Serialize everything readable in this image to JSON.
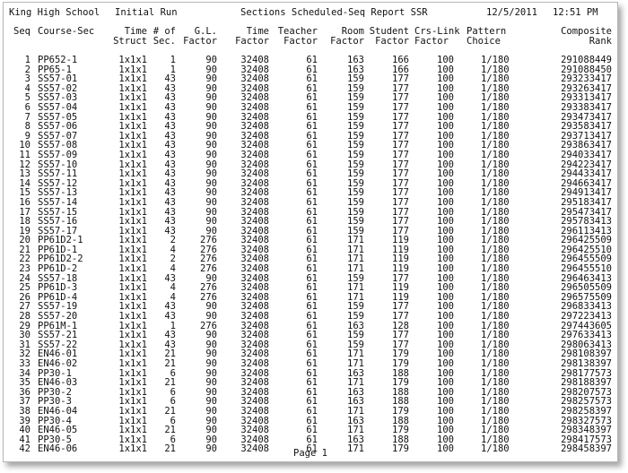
{
  "report": {
    "school": "King High School",
    "run": "Initial Run",
    "title": "Sections Scheduled-Seq Report SSR",
    "date": "12/5/2011",
    "time": "12:51 PM",
    "page_label": "Page 1"
  },
  "columns": {
    "seq": "Seq",
    "course": "Course-Sec",
    "time_struct_1": "Time",
    "time_struct_2": "Struct",
    "num_sec_1": "# of",
    "num_sec_2": "Sec.",
    "gl_1": "G.L.",
    "gl_2": "Factor",
    "time_factor_1": "Time",
    "time_factor_2": "Factor",
    "teacher_1": "Teacher",
    "teacher_2": "Factor",
    "room_1": "Room",
    "room_2": "Factor",
    "student_1": "Student",
    "student_2": "Factor",
    "crslink_1": "Crs-Link",
    "crslink_2": "Factor",
    "pattern_1": "Pattern",
    "pattern_2": "Choice",
    "rank_1": "Composite",
    "rank_2": "Rank"
  },
  "rows": [
    [
      "1",
      "PP652-1",
      "1x1x1",
      "1",
      "90",
      "32408",
      "61",
      "163",
      "166",
      "100",
      "1/180",
      "291088449"
    ],
    [
      "2",
      "PP65-1",
      "1x1x1",
      "1",
      "90",
      "32408",
      "61",
      "163",
      "166",
      "100",
      "1/180",
      "291088450"
    ],
    [
      "3",
      "SS57-01",
      "1x1x1",
      "43",
      "90",
      "32408",
      "61",
      "159",
      "177",
      "100",
      "1/180",
      "293233417"
    ],
    [
      "4",
      "SS57-02",
      "1x1x1",
      "43",
      "90",
      "32408",
      "61",
      "159",
      "177",
      "100",
      "1/180",
      "293263417"
    ],
    [
      "5",
      "SS57-03",
      "1x1x1",
      "43",
      "90",
      "32408",
      "61",
      "159",
      "177",
      "100",
      "1/180",
      "293313417"
    ],
    [
      "6",
      "SS57-04",
      "1x1x1",
      "43",
      "90",
      "32408",
      "61",
      "159",
      "177",
      "100",
      "1/180",
      "293383417"
    ],
    [
      "7",
      "SS57-05",
      "1x1x1",
      "43",
      "90",
      "32408",
      "61",
      "159",
      "177",
      "100",
      "1/180",
      "293473417"
    ],
    [
      "8",
      "SS57-06",
      "1x1x1",
      "43",
      "90",
      "32408",
      "61",
      "159",
      "177",
      "100",
      "1/180",
      "293583417"
    ],
    [
      "9",
      "SS57-07",
      "1x1x1",
      "43",
      "90",
      "32408",
      "61",
      "159",
      "177",
      "100",
      "1/180",
      "293713417"
    ],
    [
      "10",
      "SS57-08",
      "1x1x1",
      "43",
      "90",
      "32408",
      "61",
      "159",
      "177",
      "100",
      "1/180",
      "293863417"
    ],
    [
      "11",
      "SS57-09",
      "1x1x1",
      "43",
      "90",
      "32408",
      "61",
      "159",
      "177",
      "100",
      "1/180",
      "294033417"
    ],
    [
      "12",
      "SS57-10",
      "1x1x1",
      "43",
      "90",
      "32408",
      "61",
      "159",
      "177",
      "100",
      "1/180",
      "294223417"
    ],
    [
      "13",
      "SS57-11",
      "1x1x1",
      "43",
      "90",
      "32408",
      "61",
      "159",
      "177",
      "100",
      "1/180",
      "294433417"
    ],
    [
      "14",
      "SS57-12",
      "1x1x1",
      "43",
      "90",
      "32408",
      "61",
      "159",
      "177",
      "100",
      "1/180",
      "294663417"
    ],
    [
      "15",
      "SS57-13",
      "1x1x1",
      "43",
      "90",
      "32408",
      "61",
      "159",
      "177",
      "100",
      "1/180",
      "294913417"
    ],
    [
      "16",
      "SS57-14",
      "1x1x1",
      "43",
      "90",
      "32408",
      "61",
      "159",
      "177",
      "100",
      "1/180",
      "295183417"
    ],
    [
      "17",
      "SS57-15",
      "1x1x1",
      "43",
      "90",
      "32408",
      "61",
      "159",
      "177",
      "100",
      "1/180",
      "295473417"
    ],
    [
      "18",
      "SS57-16",
      "1x1x1",
      "43",
      "90",
      "32408",
      "61",
      "159",
      "177",
      "100",
      "1/180",
      "295783413"
    ],
    [
      "19",
      "SS57-17",
      "1x1x1",
      "43",
      "90",
      "32408",
      "61",
      "159",
      "177",
      "100",
      "1/180",
      "296113413"
    ],
    [
      "20",
      "PP61D2-1",
      "1x1x1",
      "2",
      "276",
      "32408",
      "61",
      "171",
      "119",
      "100",
      "1/180",
      "296425509"
    ],
    [
      "21",
      "PP61D-1",
      "1x1x1",
      "4",
      "276",
      "32408",
      "61",
      "171",
      "119",
      "100",
      "1/180",
      "296425510"
    ],
    [
      "22",
      "PP61D2-2",
      "1x1x1",
      "2",
      "276",
      "32408",
      "61",
      "171",
      "119",
      "100",
      "1/180",
      "296455509"
    ],
    [
      "23",
      "PP61D-2",
      "1x1x1",
      "4",
      "276",
      "32408",
      "61",
      "171",
      "119",
      "100",
      "1/180",
      "296455510"
    ],
    [
      "24",
      "SS57-18",
      "1x1x1",
      "43",
      "90",
      "32408",
      "61",
      "159",
      "177",
      "100",
      "1/180",
      "296463413"
    ],
    [
      "25",
      "PP61D-3",
      "1x1x1",
      "4",
      "276",
      "32408",
      "61",
      "171",
      "119",
      "100",
      "1/180",
      "296505509"
    ],
    [
      "26",
      "PP61D-4",
      "1x1x1",
      "4",
      "276",
      "32408",
      "61",
      "171",
      "119",
      "100",
      "1/180",
      "296575509"
    ],
    [
      "27",
      "SS57-19",
      "1x1x1",
      "43",
      "90",
      "32408",
      "61",
      "159",
      "177",
      "100",
      "1/180",
      "296833413"
    ],
    [
      "28",
      "SS57-20",
      "1x1x1",
      "43",
      "90",
      "32408",
      "61",
      "159",
      "177",
      "100",
      "1/180",
      "297223413"
    ],
    [
      "29",
      "PP61M-1",
      "1x1x1",
      "1",
      "276",
      "32408",
      "61",
      "163",
      "128",
      "100",
      "1/180",
      "297443605"
    ],
    [
      "30",
      "SS57-21",
      "1x1x1",
      "43",
      "90",
      "32408",
      "61",
      "159",
      "177",
      "100",
      "1/180",
      "297633413"
    ],
    [
      "31",
      "SS57-22",
      "1x1x1",
      "43",
      "90",
      "32408",
      "61",
      "159",
      "177",
      "100",
      "1/180",
      "298063413"
    ],
    [
      "32",
      "EN46-01",
      "1x1x1",
      "21",
      "90",
      "32408",
      "61",
      "171",
      "179",
      "100",
      "1/180",
      "298108397"
    ],
    [
      "33",
      "EN46-02",
      "1x1x1",
      "21",
      "90",
      "32408",
      "61",
      "171",
      "179",
      "100",
      "1/180",
      "298138397"
    ],
    [
      "34",
      "PP30-1",
      "1x1x1",
      "6",
      "90",
      "32408",
      "61",
      "163",
      "188",
      "100",
      "1/180",
      "298177573"
    ],
    [
      "35",
      "EN46-03",
      "1x1x1",
      "21",
      "90",
      "32408",
      "61",
      "171",
      "179",
      "100",
      "1/180",
      "298188397"
    ],
    [
      "36",
      "PP30-2",
      "1x1x1",
      "6",
      "90",
      "32408",
      "61",
      "163",
      "188",
      "100",
      "1/180",
      "298207573"
    ],
    [
      "37",
      "PP30-3",
      "1x1x1",
      "6",
      "90",
      "32408",
      "61",
      "163",
      "188",
      "100",
      "1/180",
      "298257573"
    ],
    [
      "38",
      "EN46-04",
      "1x1x1",
      "21",
      "90",
      "32408",
      "61",
      "171",
      "179",
      "100",
      "1/180",
      "298258397"
    ],
    [
      "39",
      "PP30-4",
      "1x1x1",
      "6",
      "90",
      "32408",
      "61",
      "163",
      "188",
      "100",
      "1/180",
      "298327573"
    ],
    [
      "40",
      "EN46-05",
      "1x1x1",
      "21",
      "90",
      "32408",
      "61",
      "171",
      "179",
      "100",
      "1/180",
      "298348397"
    ],
    [
      "41",
      "PP30-5",
      "1x1x1",
      "6",
      "90",
      "32408",
      "61",
      "163",
      "188",
      "100",
      "1/180",
      "298417573"
    ],
    [
      "42",
      "EN46-06",
      "1x1x1",
      "21",
      "90",
      "32408",
      "61",
      "171",
      "179",
      "100",
      "1/180",
      "298458397"
    ]
  ]
}
